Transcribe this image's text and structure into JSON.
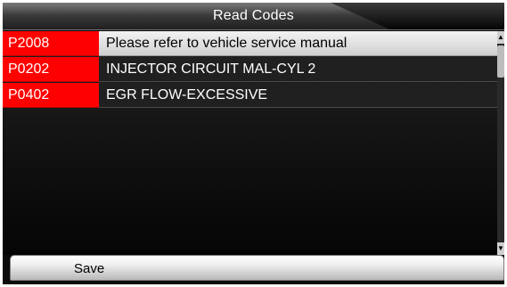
{
  "header": {
    "title": "Read  Codes"
  },
  "codes": [
    {
      "code": "P2008",
      "description": "Please refer to vehicle service manual"
    },
    {
      "code": "P0202",
      "description": "INJECTOR CIRCUIT MAL-CYL 2"
    },
    {
      "code": "P0402",
      "description": "EGR FLOW-EXCESSIVE"
    }
  ],
  "footer": {
    "save_label": "Save"
  },
  "colors": {
    "code_background": "#ff0000",
    "selected_row_background": "#dedede",
    "screen_background": "#000000"
  }
}
